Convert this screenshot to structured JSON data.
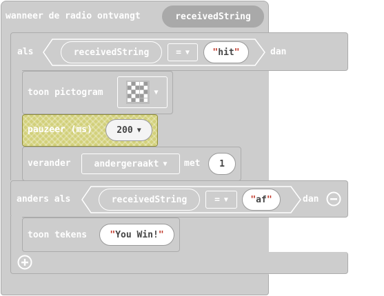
{
  "event": {
    "label": "wanneer de radio ontvangt",
    "variable": "receivedString"
  },
  "if_block": {
    "label": "als",
    "left_var": "receivedString",
    "operator": "=",
    "value": "hit",
    "then_label": "dan",
    "body": [
      {
        "label": "toon pictogram"
      },
      {
        "label": "pauzeer (ms)",
        "value": "200"
      },
      {
        "label": "verander",
        "variable": "andergeraakt",
        "with_label": "met",
        "value": "1"
      }
    ]
  },
  "else_if_block": {
    "label": "anders als",
    "left_var": "receivedString",
    "operator": "=",
    "value": "af",
    "then_label": "dan",
    "body": [
      {
        "label": "toon tekens",
        "value": "You Win!"
      }
    ]
  },
  "colors": {
    "block": "#cdcdcd",
    "border": "#ababab",
    "highlight": "#d2d07a",
    "string_quote": "#c0392b"
  },
  "icons": [
    "minus-circle-icon",
    "plus-circle-icon",
    "dropdown-triangle-icon",
    "led-pictogram-icon"
  ]
}
